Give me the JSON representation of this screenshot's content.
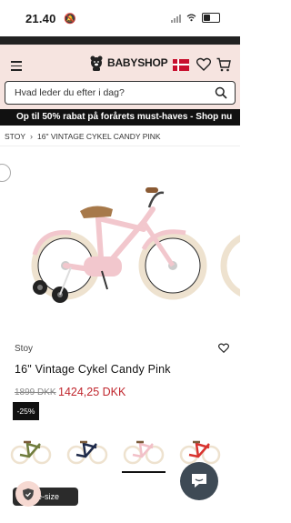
{
  "status": {
    "time": "21.40",
    "mute_icon": "bell-slash-icon"
  },
  "header": {
    "brand": "BABYSHOP",
    "icons": [
      "menu-icon",
      "denmark-flag-icon",
      "heart-icon",
      "cart-icon"
    ]
  },
  "search": {
    "placeholder": "Hvad leder du efter i dag?"
  },
  "promo": {
    "text": "Op til 50% rabat på forårets must-haves - Shop nu"
  },
  "breadcrumb": {
    "items": [
      "STOY",
      "16\" VINTAGE CYKEL CANDY PINK"
    ]
  },
  "product": {
    "brand": "Stoy",
    "title": "16\" Vintage Cykel Candy Pink",
    "price_old": "1899 DKK",
    "price_new": "1424,25 DKK",
    "discount": "-25%",
    "image_color": "#f2c7cd",
    "variants": [
      {
        "color": "green",
        "hex": "#6f7c3d",
        "active": false
      },
      {
        "color": "navy",
        "hex": "#1e2a4a",
        "active": false
      },
      {
        "color": "pink",
        "hex": "#f2c0c8",
        "active": true
      },
      {
        "color": "red",
        "hex": "#d8332f",
        "active": false
      }
    ]
  },
  "size_button": {
    "label": "e-size"
  }
}
